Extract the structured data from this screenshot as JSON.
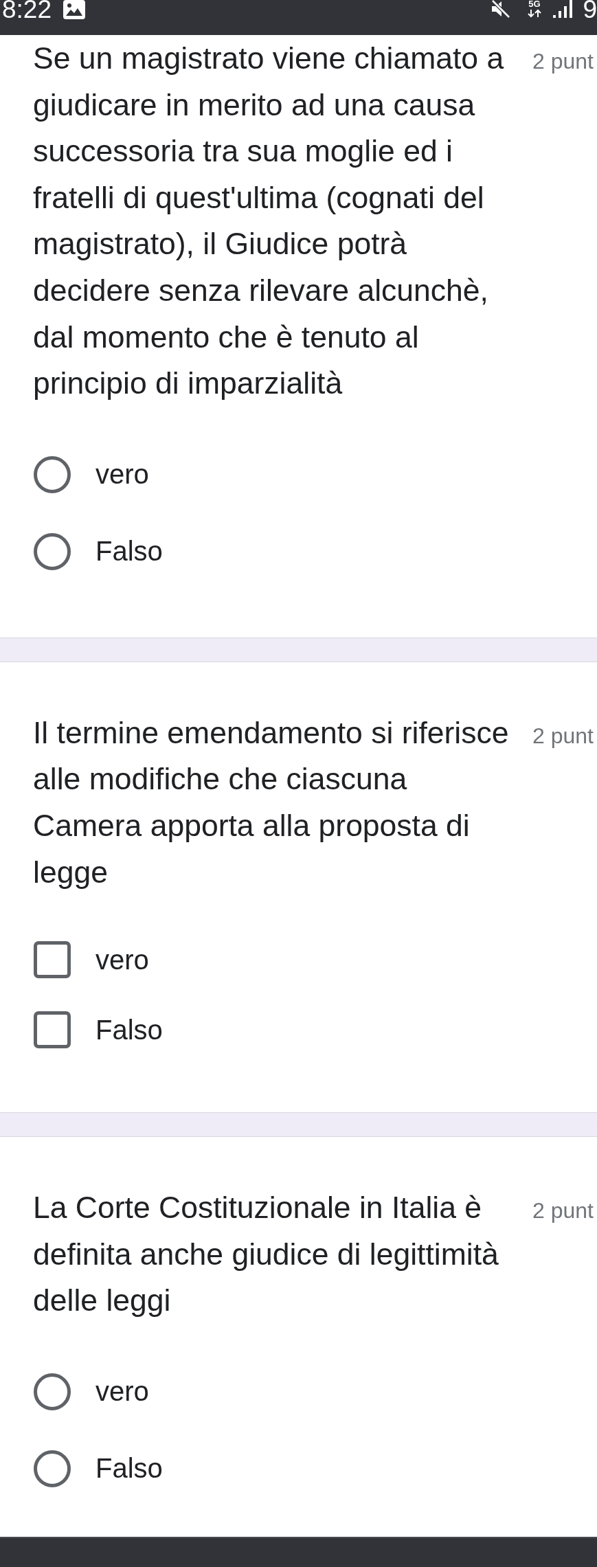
{
  "status_bar": {
    "time": "8:22",
    "network": "5G",
    "battery_percent": "9"
  },
  "questions": [
    {
      "kind": "radio",
      "text": "Se un magistrato viene chiamato a giudicare in merito ad una causa successoria tra sua moglie ed i fratelli di quest'ultima (cognati del magistrato), il Giudice potrà decidere senza rilevare alcunchè, dal momento che è tenuto al principio di imparzialità",
      "points": "2 punt",
      "options": [
        {
          "label": "vero",
          "selected": false
        },
        {
          "label": "Falso",
          "selected": false
        }
      ]
    },
    {
      "kind": "checkbox",
      "text": "Il termine emendamento si riferisce alle modifiche che ciascuna Camera apporta alla proposta di legge",
      "points": "2 punt",
      "options": [
        {
          "label": "vero",
          "checked": false
        },
        {
          "label": "Falso",
          "checked": false
        }
      ]
    },
    {
      "kind": "radio",
      "text": "La Corte Costituzionale in Italia è definita anche giudice di legittimità delle leggi",
      "points": "2 punt",
      "options": [
        {
          "label": "vero",
          "selected": false
        },
        {
          "label": "Falso",
          "selected": false
        }
      ]
    }
  ]
}
